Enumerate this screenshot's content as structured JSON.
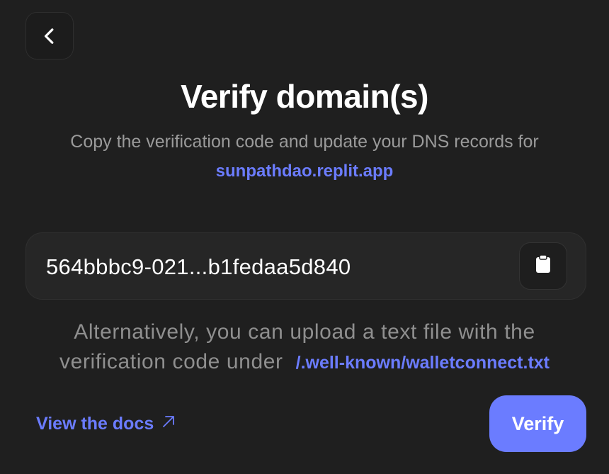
{
  "header": {
    "back_icon": "chevron-left-icon",
    "title": "Verify domain(s)",
    "subtitle": "Copy the verification code and update your DNS records for",
    "domain": "sunpathdao.replit.app"
  },
  "code": {
    "value": "564bbbc9-021...b1fedaa5d840",
    "copy_icon": "clipboard-icon"
  },
  "alternative": {
    "line1": "Alternatively, you can upload a text file with the",
    "line2": "verification code under",
    "path": "/.well-known/walletconnect.txt"
  },
  "footer": {
    "docs_label": "View the docs",
    "docs_icon": "arrow-up-right-icon",
    "verify_label": "Verify"
  },
  "colors": {
    "background": "#1f1f1f",
    "accent": "#6b7cff",
    "muted_text": "#9a9a9a"
  }
}
